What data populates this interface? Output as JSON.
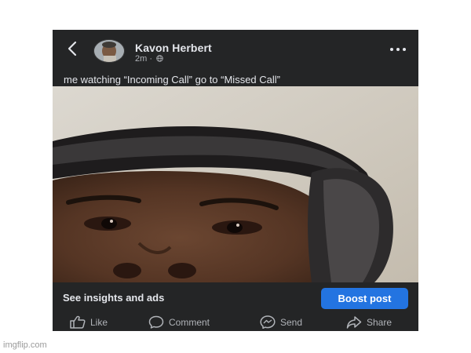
{
  "post": {
    "author": "Kavon Herbert",
    "time": "2m",
    "separator": "·",
    "caption": "me watching “Incoming Call” go to “Missed Call”",
    "back_icon": "chevron-left-icon",
    "more_icon": "more-horizontal-icon",
    "privacy_icon": "globe-icon"
  },
  "insights": {
    "link_label": "See insights and ads",
    "boost_label": "Boost post"
  },
  "actions": [
    {
      "label": "Like",
      "icon": "thumbs-up-icon"
    },
    {
      "label": "Comment",
      "icon": "comment-icon"
    },
    {
      "label": "Send",
      "icon": "messenger-icon"
    },
    {
      "label": "Share",
      "icon": "share-icon"
    }
  ],
  "watermark": "imgflip.com",
  "colors": {
    "post_background": "#242526",
    "primary_text": "#e4e6eb",
    "secondary_text": "#b0b3b8",
    "boost_button": "#2374e1"
  }
}
